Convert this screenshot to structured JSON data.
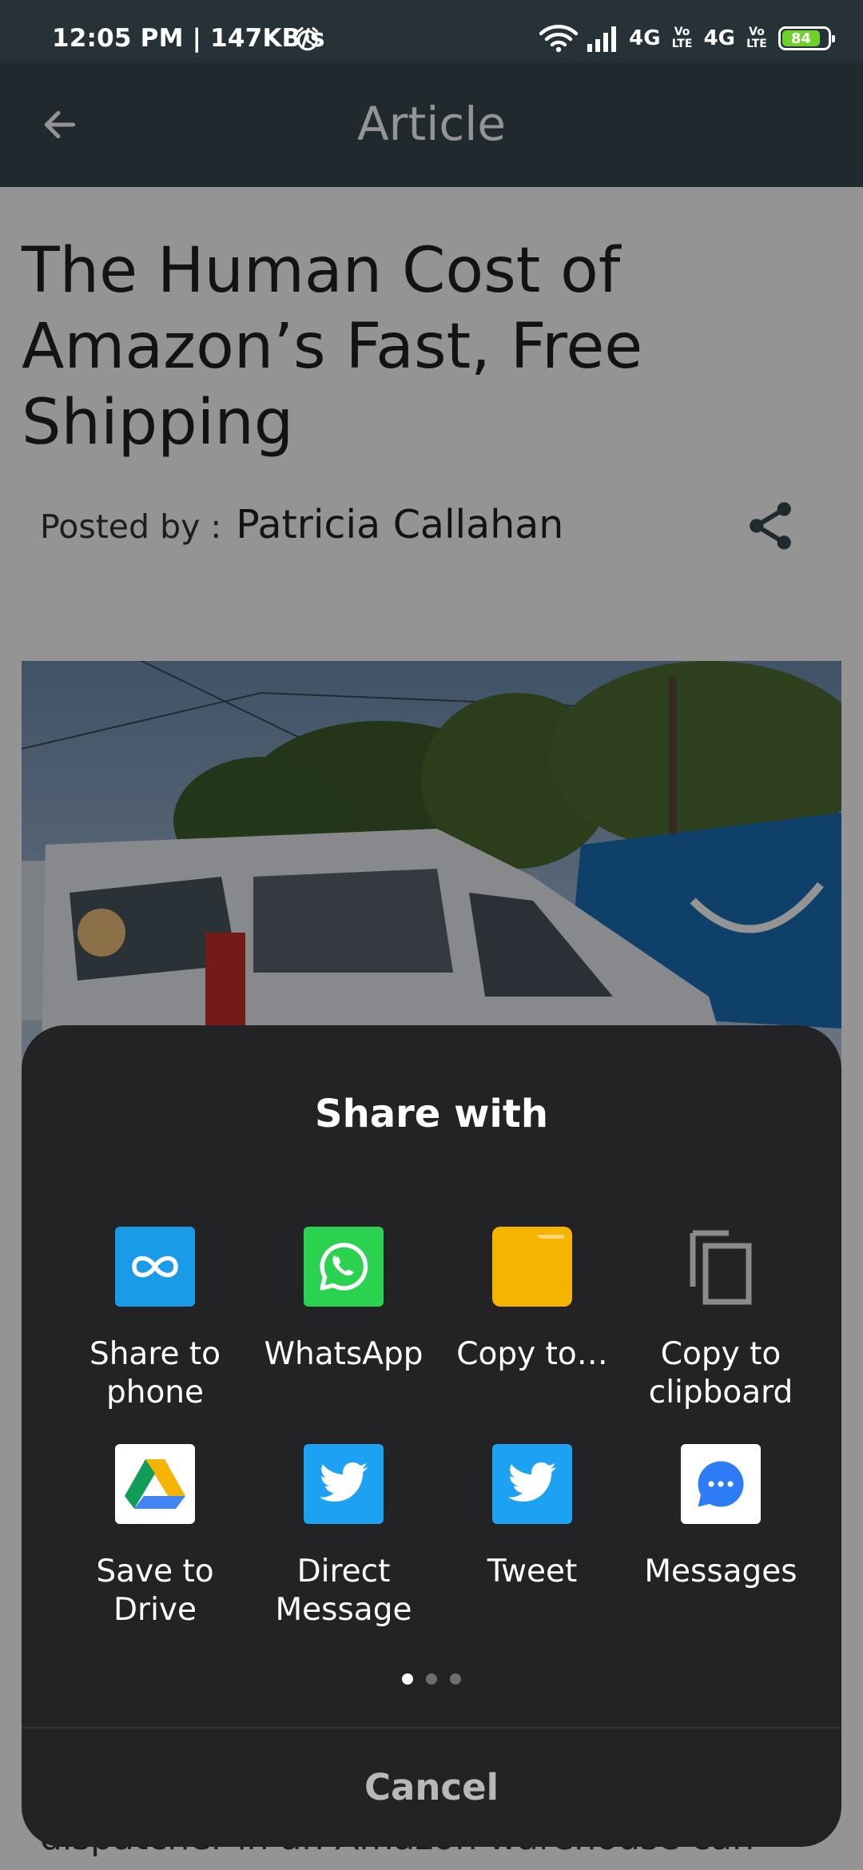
{
  "status_bar": {
    "time": "12:05 PM | 147KB/s",
    "network_1": "4G",
    "volte_1": "Vo LTE",
    "network_2": "4G",
    "volte_2": "Vo LTE",
    "battery": "84",
    "icons": [
      "alarm-icon",
      "wifi-icon",
      "signal-icon"
    ]
  },
  "app_bar": {
    "title": "Article",
    "back_icon": "arrow-left-icon"
  },
  "article": {
    "title": "The Human Cost of Amazon’s Fast, Free Shipping",
    "posted_label": "Posted by :",
    "author": "Patricia Callahan",
    "share_icon": "share-icon",
    "body_peek": "dispatcher in an Amazon warehouse can"
  },
  "share_sheet": {
    "title": "Share with",
    "items": [
      {
        "label": "Share to phone",
        "icon": "share-to-phone-icon",
        "color": "#1a9be8"
      },
      {
        "label": "WhatsApp",
        "icon": "whatsapp-icon",
        "color": "#2bd24f"
      },
      {
        "label": "Copy to…",
        "icon": "folder-icon",
        "color": "#f4b400"
      },
      {
        "label": "Copy to clipboard",
        "icon": "clipboard-icon",
        "color": "#8a8a8a"
      },
      {
        "label": "Save to Drive",
        "icon": "google-drive-icon",
        "color": "#ffffff"
      },
      {
        "label": "Direct Message",
        "icon": "twitter-icon",
        "color": "#1da1f2"
      },
      {
        "label": "Tweet",
        "icon": "twitter-icon",
        "color": "#1da1f2"
      },
      {
        "label": "Messages",
        "icon": "messages-icon",
        "color": "#ffffff"
      }
    ],
    "page_indicator": {
      "current": 1,
      "total": 3
    },
    "cancel_label": "Cancel"
  }
}
